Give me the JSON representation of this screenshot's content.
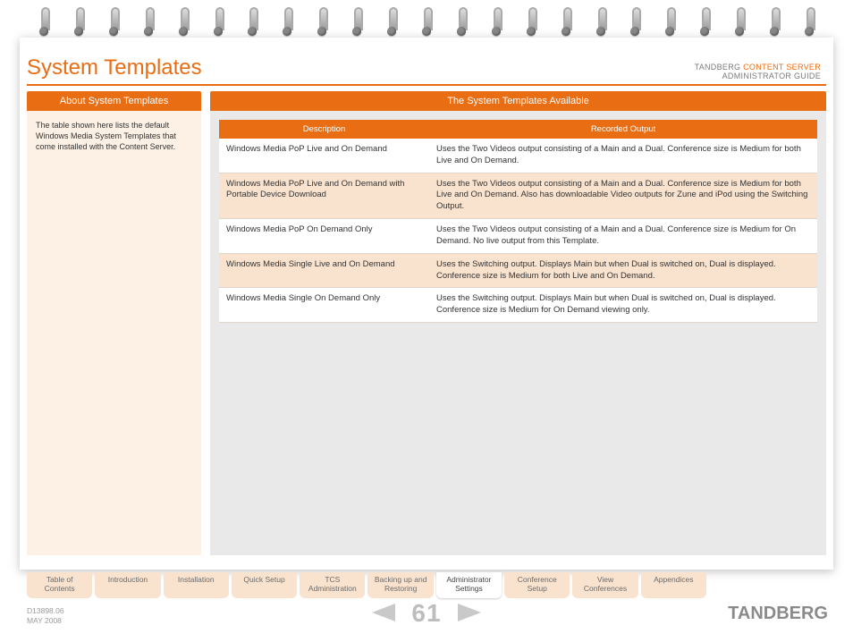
{
  "header": {
    "title": "System Templates",
    "brand_line1_a": "TANDBERG ",
    "brand_line1_b": "CONTENT SERVER",
    "brand_line2": "ADMINISTRATOR GUIDE"
  },
  "tabs": {
    "left": "About System Templates",
    "right": "The System Templates Available"
  },
  "about_text": "The table shown here lists the default Windows Media System Templates that come installed with the Content Server.",
  "table": {
    "headers": {
      "desc": "Description",
      "output": "Recorded Output"
    },
    "rows": [
      {
        "desc": "Windows Media PoP Live and On Demand",
        "output": "Uses the Two Videos output consisting of a Main and a Dual. Conference size is Medium for both Live and On Demand."
      },
      {
        "desc": "Windows Media PoP Live and On Demand with Portable Device Download",
        "output": "Uses the Two Videos output consisting of a Main and a Dual. Conference size is Medium for both Live and On Demand. Also has downloadable Video outputs for Zune and iPod using the Switching Output."
      },
      {
        "desc": "Windows Media PoP On Demand Only",
        "output": "Uses the Two Videos output consisting of a Main and a Dual. Conference size is Medium for On Demand. No live output from this Template."
      },
      {
        "desc": "Windows Media Single Live and On Demand",
        "output": "Uses the Switching output. Displays Main but when Dual is switched on, Dual is displayed. Conference size is Medium for both Live and On Demand."
      },
      {
        "desc": "Windows Media Single On Demand Only",
        "output": "Uses the Switching output. Displays Main but when Dual is switched on, Dual is displayed. Conference size is Medium for On Demand viewing only."
      }
    ]
  },
  "nav": [
    "Table of\nContents",
    "Introduction",
    "Installation",
    "Quick Setup",
    "TCS\nAdministration",
    "Backing up and\nRestoring",
    "Administrator\nSettings",
    "Conference\nSetup",
    "View\nConferences",
    "Appendices"
  ],
  "nav_active_index": 6,
  "footer": {
    "doc_id": "D13898.06",
    "date": "MAY 2008",
    "page": "61",
    "brand": "TANDBERG"
  }
}
